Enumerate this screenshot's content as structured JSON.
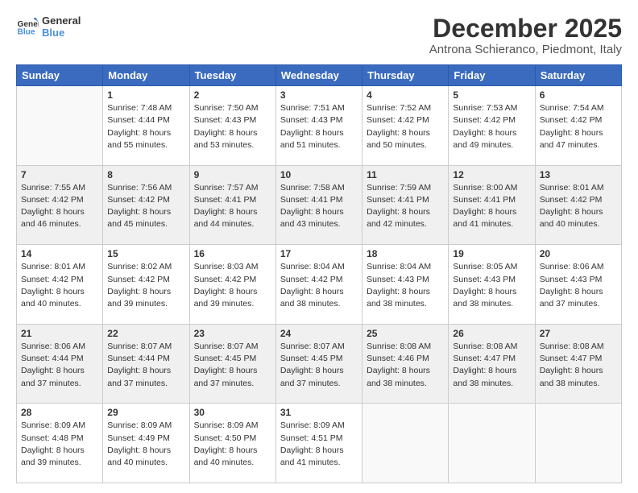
{
  "header": {
    "logo_line1": "General",
    "logo_line2": "Blue",
    "month": "December 2025",
    "location": "Antrona Schieranco, Piedmont, Italy"
  },
  "weekdays": [
    "Sunday",
    "Monday",
    "Tuesday",
    "Wednesday",
    "Thursday",
    "Friday",
    "Saturday"
  ],
  "weeks": [
    [
      {
        "day": "",
        "info": ""
      },
      {
        "day": "1",
        "info": "Sunrise: 7:48 AM\nSunset: 4:44 PM\nDaylight: 8 hours\nand 55 minutes."
      },
      {
        "day": "2",
        "info": "Sunrise: 7:50 AM\nSunset: 4:43 PM\nDaylight: 8 hours\nand 53 minutes."
      },
      {
        "day": "3",
        "info": "Sunrise: 7:51 AM\nSunset: 4:43 PM\nDaylight: 8 hours\nand 51 minutes."
      },
      {
        "day": "4",
        "info": "Sunrise: 7:52 AM\nSunset: 4:42 PM\nDaylight: 8 hours\nand 50 minutes."
      },
      {
        "day": "5",
        "info": "Sunrise: 7:53 AM\nSunset: 4:42 PM\nDaylight: 8 hours\nand 49 minutes."
      },
      {
        "day": "6",
        "info": "Sunrise: 7:54 AM\nSunset: 4:42 PM\nDaylight: 8 hours\nand 47 minutes."
      }
    ],
    [
      {
        "day": "7",
        "info": "Sunrise: 7:55 AM\nSunset: 4:42 PM\nDaylight: 8 hours\nand 46 minutes."
      },
      {
        "day": "8",
        "info": "Sunrise: 7:56 AM\nSunset: 4:42 PM\nDaylight: 8 hours\nand 45 minutes."
      },
      {
        "day": "9",
        "info": "Sunrise: 7:57 AM\nSunset: 4:41 PM\nDaylight: 8 hours\nand 44 minutes."
      },
      {
        "day": "10",
        "info": "Sunrise: 7:58 AM\nSunset: 4:41 PM\nDaylight: 8 hours\nand 43 minutes."
      },
      {
        "day": "11",
        "info": "Sunrise: 7:59 AM\nSunset: 4:41 PM\nDaylight: 8 hours\nand 42 minutes."
      },
      {
        "day": "12",
        "info": "Sunrise: 8:00 AM\nSunset: 4:41 PM\nDaylight: 8 hours\nand 41 minutes."
      },
      {
        "day": "13",
        "info": "Sunrise: 8:01 AM\nSunset: 4:42 PM\nDaylight: 8 hours\nand 40 minutes."
      }
    ],
    [
      {
        "day": "14",
        "info": "Sunrise: 8:01 AM\nSunset: 4:42 PM\nDaylight: 8 hours\nand 40 minutes."
      },
      {
        "day": "15",
        "info": "Sunrise: 8:02 AM\nSunset: 4:42 PM\nDaylight: 8 hours\nand 39 minutes."
      },
      {
        "day": "16",
        "info": "Sunrise: 8:03 AM\nSunset: 4:42 PM\nDaylight: 8 hours\nand 39 minutes."
      },
      {
        "day": "17",
        "info": "Sunrise: 8:04 AM\nSunset: 4:42 PM\nDaylight: 8 hours\nand 38 minutes."
      },
      {
        "day": "18",
        "info": "Sunrise: 8:04 AM\nSunset: 4:43 PM\nDaylight: 8 hours\nand 38 minutes."
      },
      {
        "day": "19",
        "info": "Sunrise: 8:05 AM\nSunset: 4:43 PM\nDaylight: 8 hours\nand 38 minutes."
      },
      {
        "day": "20",
        "info": "Sunrise: 8:06 AM\nSunset: 4:43 PM\nDaylight: 8 hours\nand 37 minutes."
      }
    ],
    [
      {
        "day": "21",
        "info": "Sunrise: 8:06 AM\nSunset: 4:44 PM\nDaylight: 8 hours\nand 37 minutes."
      },
      {
        "day": "22",
        "info": "Sunrise: 8:07 AM\nSunset: 4:44 PM\nDaylight: 8 hours\nand 37 minutes."
      },
      {
        "day": "23",
        "info": "Sunrise: 8:07 AM\nSunset: 4:45 PM\nDaylight: 8 hours\nand 37 minutes."
      },
      {
        "day": "24",
        "info": "Sunrise: 8:07 AM\nSunset: 4:45 PM\nDaylight: 8 hours\nand 37 minutes."
      },
      {
        "day": "25",
        "info": "Sunrise: 8:08 AM\nSunset: 4:46 PM\nDaylight: 8 hours\nand 38 minutes."
      },
      {
        "day": "26",
        "info": "Sunrise: 8:08 AM\nSunset: 4:47 PM\nDaylight: 8 hours\nand 38 minutes."
      },
      {
        "day": "27",
        "info": "Sunrise: 8:08 AM\nSunset: 4:47 PM\nDaylight: 8 hours\nand 38 minutes."
      }
    ],
    [
      {
        "day": "28",
        "info": "Sunrise: 8:09 AM\nSunset: 4:48 PM\nDaylight: 8 hours\nand 39 minutes."
      },
      {
        "day": "29",
        "info": "Sunrise: 8:09 AM\nSunset: 4:49 PM\nDaylight: 8 hours\nand 40 minutes."
      },
      {
        "day": "30",
        "info": "Sunrise: 8:09 AM\nSunset: 4:50 PM\nDaylight: 8 hours\nand 40 minutes."
      },
      {
        "day": "31",
        "info": "Sunrise: 8:09 AM\nSunset: 4:51 PM\nDaylight: 8 hours\nand 41 minutes."
      },
      {
        "day": "",
        "info": ""
      },
      {
        "day": "",
        "info": ""
      },
      {
        "day": "",
        "info": ""
      }
    ]
  ]
}
